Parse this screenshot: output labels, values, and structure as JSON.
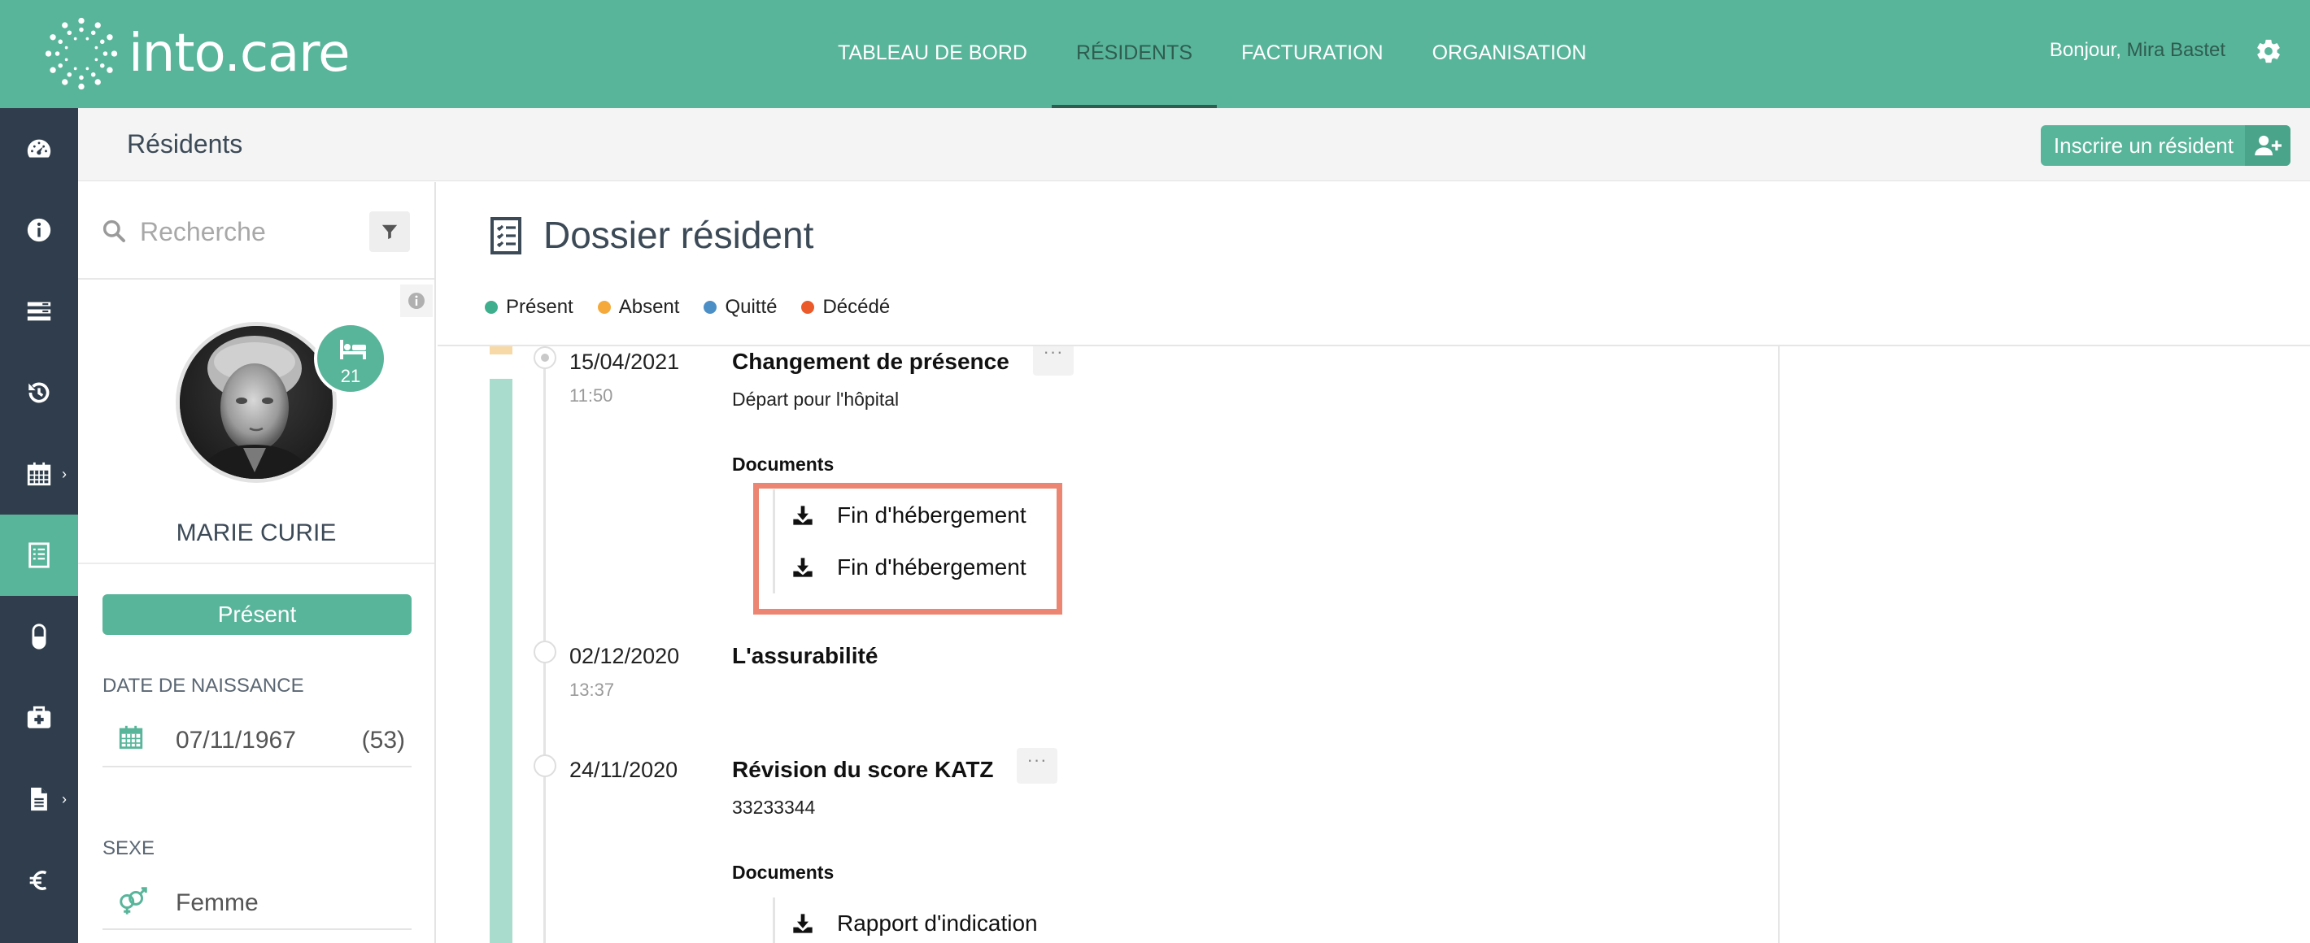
{
  "brand": {
    "name": "into.care"
  },
  "nav": {
    "items": [
      {
        "label": "TABLEAU DE BORD"
      },
      {
        "label": "RÉSIDENTS"
      },
      {
        "label": "FACTURATION"
      },
      {
        "label": "ORGANISATION"
      }
    ],
    "greeting": "Bonjour,",
    "user_name": "Mira Bastet"
  },
  "sidebar_icons": [
    "dashboard-icon",
    "info-icon",
    "list-icon",
    "history-icon",
    "calendar-icon",
    "dossier-icon",
    "pill-icon",
    "medkit-icon",
    "document-icon",
    "euro-icon"
  ],
  "subheader": {
    "title": "Résidents",
    "add_button": "Inscrire un résident"
  },
  "search": {
    "placeholder": "Recherche"
  },
  "resident": {
    "name": "MARIE CURIE",
    "bed_number": "21",
    "status": "Présent",
    "birth_label": "DATE DE NAISSANCE",
    "birth_date": "07/11/1967",
    "age": "(53)",
    "sex_label": "SEXE",
    "sex": "Femme"
  },
  "dossier": {
    "title": "Dossier résident",
    "legend": [
      {
        "label": "Présent",
        "color": "#3fae8c"
      },
      {
        "label": "Absent",
        "color": "#f5a93a"
      },
      {
        "label": "Quitté",
        "color": "#4b8fc6"
      },
      {
        "label": "Décédé",
        "color": "#ea5a2b"
      }
    ]
  },
  "events": [
    {
      "date": "15/04/2021",
      "time": "11:50",
      "title": "Changement de présence",
      "desc": "Départ pour l'hôpital",
      "docs_label": "Documents",
      "docs": [
        "Fin d'hébergement",
        "Fin d'hébergement"
      ],
      "more": "···"
    },
    {
      "date": "02/12/2020",
      "time": "13:37",
      "title": "L'assurabilité"
    },
    {
      "date": "24/11/2020",
      "title": "Révision du score KATZ",
      "desc": "33233344",
      "docs_label": "Documents",
      "docs": [
        "Rapport d'indication"
      ],
      "more": "···"
    }
  ],
  "colors": {
    "brand": "#59b59a",
    "sidebar": "#2f3d4c",
    "highlight": "#ec8571"
  }
}
